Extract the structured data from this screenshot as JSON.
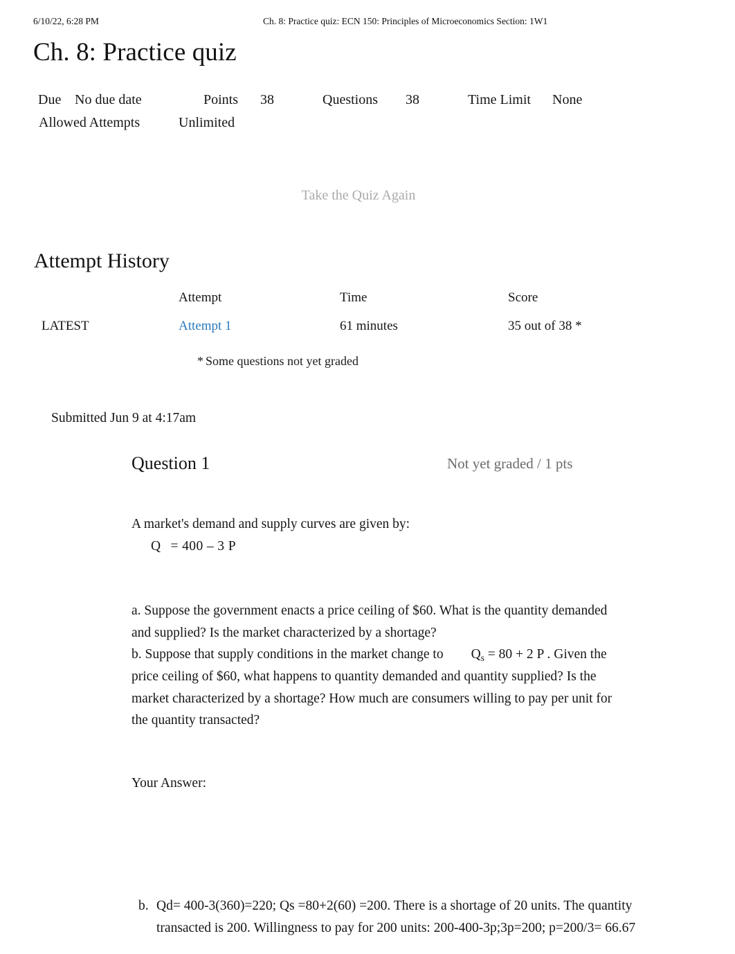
{
  "print_header": {
    "date": "6/10/22, 6:28 PM",
    "document_title": "Ch. 8: Practice quiz: ECN 150: Principles of Microeconomics Section: 1W1"
  },
  "quiz": {
    "title": "Ch. 8: Practice quiz",
    "meta": {
      "due_label": "Due",
      "due_value": "No due date",
      "points_label": "Points",
      "points_value": "38",
      "questions_label": "Questions",
      "questions_value": "38",
      "time_limit_label": "Time Limit",
      "time_limit_value": "None",
      "allowed_attempts_label": "Allowed Attempts",
      "allowed_attempts_value": "Unlimited"
    },
    "take_again_label": "Take the Quiz Again"
  },
  "attempt_history": {
    "heading": "Attempt History",
    "columns": {
      "kept": "",
      "attempt": "Attempt",
      "time": "Time",
      "score": "Score"
    },
    "rows": [
      {
        "kept": "LATEST",
        "attempt": "Attempt 1",
        "time": "61 minutes",
        "score": "35 out of 38 *"
      }
    ],
    "footnote_star": "*",
    "footnote_text": "Some questions not yet graded"
  },
  "submission": {
    "submitted_text": "Submitted Jun 9 at 4:17am"
  },
  "question": {
    "name": "Question 1",
    "points_status": "Not yet graded / 1 pts",
    "prompt_intro": "A market's demand and supply curves are given by:",
    "equation": {
      "variable": "Q",
      "subscript": "",
      "rest": "= 400 – 3 P"
    },
    "part_a": "a. Suppose the government enacts a price ceiling of $60. What is the quantity demanded and supplied? Is the market characterized by a shortage?",
    "part_b_lead": "b. Suppose that supply conditions in the market change to",
    "part_b_equation_var": "Q",
    "part_b_equation_sub": "s",
    "part_b_equation_rest": "= 80 + 2 P .",
    "part_b_tail": "Given the price ceiling of $60, what happens to quantity demanded and quantity supplied? Is the market characterized by a shortage? How much are consumers willing to pay per unit for the quantity transacted?",
    "your_answer_label": "Your Answer:"
  },
  "student_answer": {
    "marker": "b.",
    "text": "Qd= 400-3(360)=220; Qs =80+2(60) =200. There is a shortage of 20 units. The quantity transacted is 200. Willingness to pay for 200 units: 200-400-3p;3p=200; p=200/3= 66.67"
  },
  "colors": {
    "link_blue": "#2b7abc",
    "muted_gray": "#6b6b6b",
    "disabled_gray": "#aaaaaa",
    "text_black": "#161616"
  }
}
